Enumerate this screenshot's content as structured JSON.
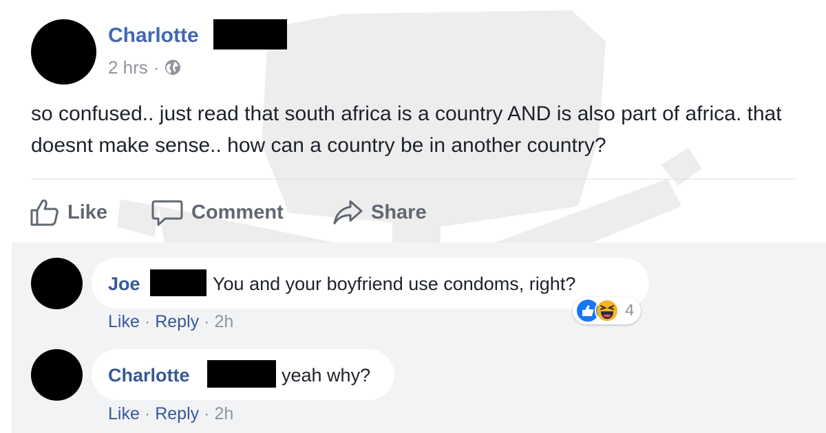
{
  "post": {
    "author": "Charlotte",
    "time": "2 hrs",
    "separator": "·",
    "privacy_icon": "globe-icon",
    "text": "so confused.. just read that south africa is a country AND is also part of africa. that doesnt make sense.. how can a country be in another country?"
  },
  "actions": {
    "like": "Like",
    "comment": "Comment",
    "share": "Share"
  },
  "comments": [
    {
      "author": "Joe",
      "text": "You and your boyfriend use condoms, right?",
      "like": "Like",
      "reply": "Reply",
      "time": "2h",
      "reactions": [
        "like-reaction-icon",
        "haha-reaction-icon"
      ],
      "reaction_count": "4"
    },
    {
      "author": "Charlotte",
      "text": "yeah why?",
      "like": "Like",
      "reply": "Reply",
      "time": "2h"
    }
  ],
  "colors": {
    "name_blue": "#4267b2",
    "link_blue": "#385898",
    "meta_gray": "#90949c",
    "action_gray": "#606770",
    "comments_bg": "#f2f3f5"
  }
}
